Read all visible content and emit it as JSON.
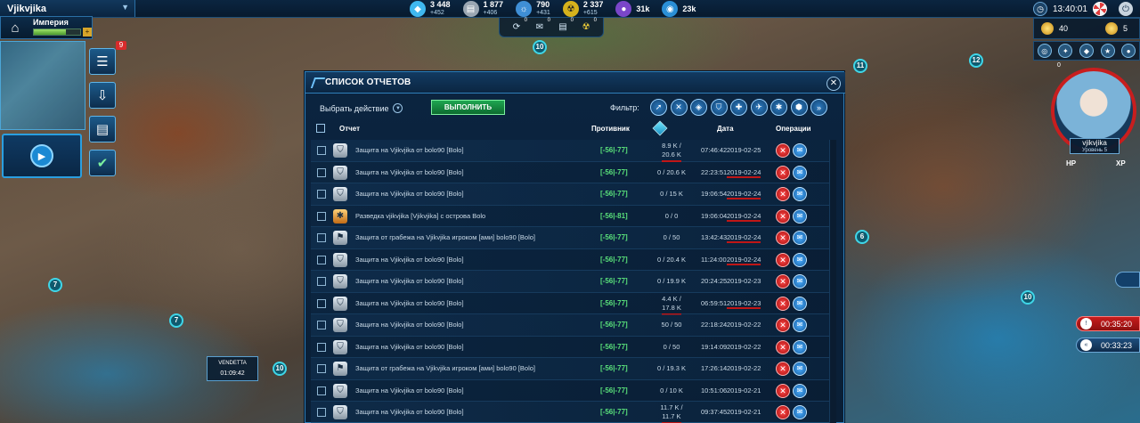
{
  "topbar": {
    "player_name": "Vjikvjika",
    "resources": [
      {
        "icon": "crystal-icon",
        "value": "3 448",
        "delta": "+452",
        "color": "#3fb8f0"
      },
      {
        "icon": "metal-icon",
        "value": "1 877",
        "delta": "+406",
        "color": "#9aa6b2"
      },
      {
        "icon": "energy-icon",
        "value": "790",
        "delta": "+431",
        "color": "#3f8fd6"
      },
      {
        "icon": "radiation-icon",
        "value": "2 337",
        "delta": "+615",
        "color": "#d6b21c"
      },
      {
        "icon": "dark-matter-icon",
        "value": "31k",
        "delta": "",
        "color": "#7a46c9"
      },
      {
        "icon": "sphere-icon",
        "value": "23k",
        "delta": "",
        "color": "#2a8fd6"
      }
    ],
    "sub_icons": [
      {
        "icon": "fleet-icon",
        "count": "0"
      },
      {
        "icon": "mail-icon",
        "count": "0"
      },
      {
        "icon": "reports-icon",
        "count": "0"
      },
      {
        "icon": "radiation-icon",
        "count": "0"
      }
    ],
    "clock": "13:40:01"
  },
  "empire": {
    "label": "Империя",
    "progress_percent": 70
  },
  "left_panel": {
    "badge": "9"
  },
  "map_markers": [
    "10",
    "11",
    "12",
    "7",
    "7",
    "6",
    "10",
    "10"
  ],
  "vendetta": {
    "title": "VENDETTA",
    "time": "01:09:42"
  },
  "right_hud": {
    "credits": "40",
    "medals": "5",
    "avatar_name": "vjikvjika",
    "avatar_level": "Уровень 5",
    "avatar_badge": "0",
    "hp_label": "HP",
    "xp_label": "XP",
    "timers": [
      "00:35:20",
      "00:33:23"
    ]
  },
  "dialog": {
    "title": "СПИСОК ОТЧЕТОВ",
    "action_label": "Выбрать действие",
    "execute_label": "ВЫПОЛНИТЬ",
    "filter_label": "Фильтр:",
    "filters": [
      "attack-filter-icon",
      "battle-filter-icon",
      "defense-filter-icon",
      "shield-filter-icon",
      "shield-star-filter-icon",
      "fleet-filter-icon",
      "spy-filter-icon",
      "transport-filter-icon",
      "double-chevron-filter-icon"
    ],
    "columns": {
      "report": "Отчет",
      "opponent": "Противник",
      "date": "Дата",
      "operations": "Операции"
    },
    "rows": [
      {
        "type": "defense",
        "title": "Защита на Vjikvjika от bolo90 [Bolo]",
        "opponent": "[-56|-77]",
        "loot": [
          "8.9 K /",
          "20.6 K"
        ],
        "time": "07:46:42",
        "date": "2019-02-25"
      },
      {
        "type": "defense",
        "title": "Защита на Vjikvjika от bolo90 [Bolo]",
        "opponent": "[-56|-77]",
        "loot": [
          "0 / 20.6 K"
        ],
        "time": "22:23:51",
        "date": "2019-02-24"
      },
      {
        "type": "defense",
        "title": "Защита на Vjikvjika от bolo90 [Bolo]",
        "opponent": "[-56|-77]",
        "loot": [
          "0 / 15 K"
        ],
        "time": "19:06:54",
        "date": "2019-02-24"
      },
      {
        "type": "spy",
        "title": "Разведка vjikvjika [Vjikvjika] с острова Bolo",
        "opponent": "[-56|-81]",
        "loot": [
          "0 / 0"
        ],
        "time": "19:06:04",
        "date": "2019-02-24"
      },
      {
        "type": "raid",
        "title": "Защита от грабежа на Vjikvjika игроком [ами] bolo90 [Bolo]",
        "opponent": "[-56|-77]",
        "loot": [
          "0 / 50"
        ],
        "time": "13:42:43",
        "date": "2019-02-24"
      },
      {
        "type": "defense",
        "title": "Защита на Vjikvjika от bolo90 [Bolo]",
        "opponent": "[-56|-77]",
        "loot": [
          "0 / 20.4 K"
        ],
        "time": "11:24:00",
        "date": "2019-02-24"
      },
      {
        "type": "defense",
        "title": "Защита на Vjikvjika от bolo90 [Bolo]",
        "opponent": "[-56|-77]",
        "loot": [
          "0 / 19.9 K"
        ],
        "time": "20:24:25",
        "date": "2019-02-23"
      },
      {
        "type": "defense",
        "title": "Защита на Vjikvjika от bolo90 [Bolo]",
        "opponent": "[-56|-77]",
        "loot": [
          "4.4 K /",
          "17.8 K"
        ],
        "time": "06:59:51",
        "date": "2019-02-23"
      },
      {
        "type": "defense",
        "title": "Защита на Vjikvjika от bolo90 [Bolo]",
        "opponent": "[-56|-77]",
        "loot": [
          "50 / 50"
        ],
        "time": "22:18:24",
        "date": "2019-02-22"
      },
      {
        "type": "defense",
        "title": "Защита на Vjikvjika от bolo90 [Bolo]",
        "opponent": "[-56|-77]",
        "loot": [
          "0 / 50"
        ],
        "time": "19:14:09",
        "date": "2019-02-22"
      },
      {
        "type": "raid",
        "title": "Защита от грабежа на Vjikvjika игроком [ами] bolo90 [Bolo]",
        "opponent": "[-56|-77]",
        "loot": [
          "0 / 19.3 K"
        ],
        "time": "17:26:14",
        "date": "2019-02-22"
      },
      {
        "type": "defense",
        "title": "Защита на Vjikvjika от bolo90 [Bolo]",
        "opponent": "[-56|-77]",
        "loot": [
          "0 / 10 K"
        ],
        "time": "10:51:06",
        "date": "2019-02-21"
      },
      {
        "type": "defense",
        "title": "Защита на Vjikvjika от bolo90 [Bolo]",
        "opponent": "[-56|-77]",
        "loot": [
          "11.7 K /",
          "11.7 K"
        ],
        "time": "09:37:45",
        "date": "2019-02-21"
      }
    ]
  }
}
